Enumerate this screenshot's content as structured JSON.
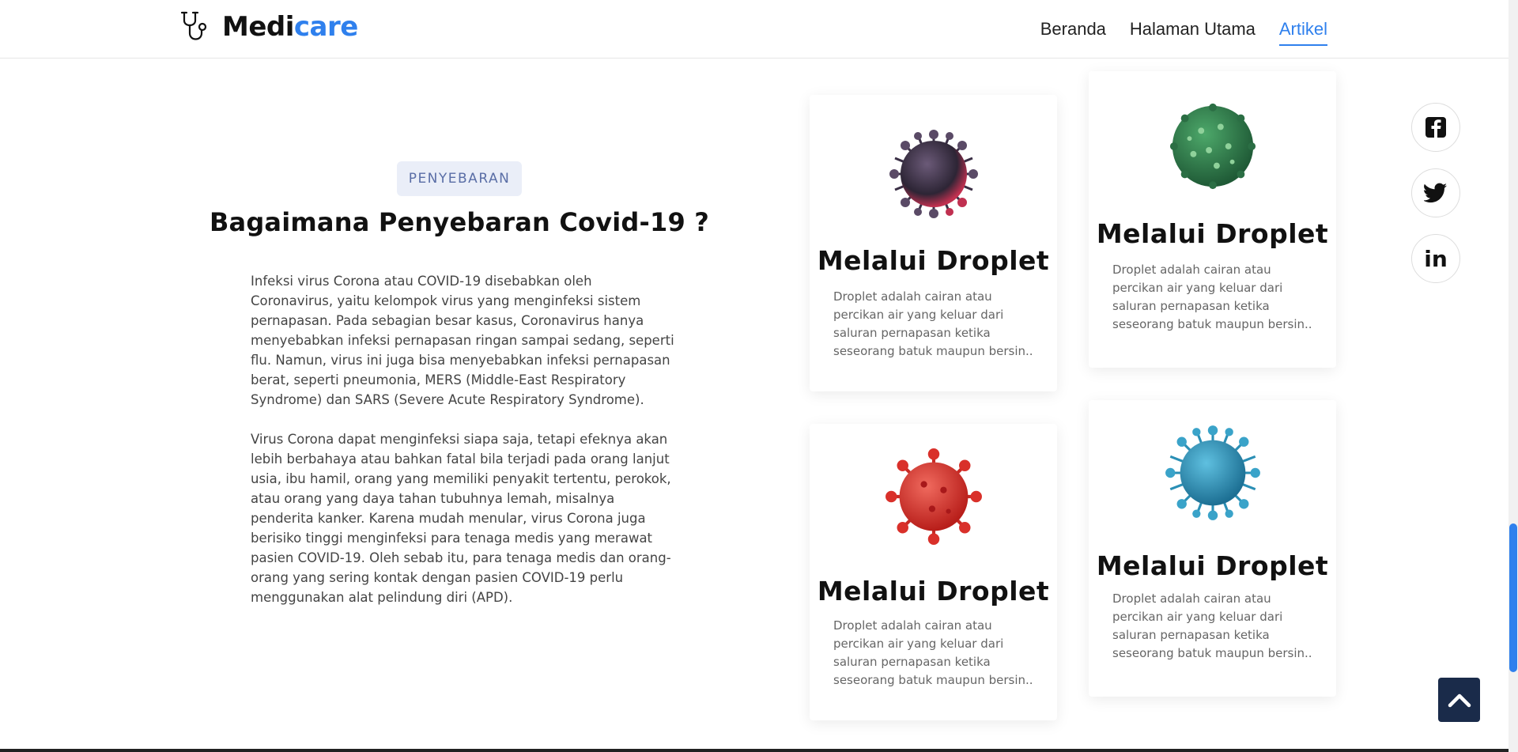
{
  "brand": {
    "name_part1": "Medi",
    "name_part2": "care",
    "accent_color": "#2f80ed",
    "icon": "stethoscope-icon"
  },
  "nav": {
    "items": [
      {
        "label": "Beranda",
        "active": false
      },
      {
        "label": "Halaman Utama",
        "active": false
      },
      {
        "label": "Artikel",
        "active": true
      }
    ]
  },
  "article": {
    "badge": "PENYEBARAN",
    "title": "Bagaimana Penyebaran Covid-19 ?",
    "paragraphs": [
      "Infeksi virus Corona atau COVID-19 disebabkan oleh Coronavirus, yaitu kelompok virus yang menginfeksi sistem pernapasan. Pada sebagian besar kasus, Coronavirus hanya menyebabkan infeksi pernapasan ringan sampai sedang, seperti flu. Namun, virus ini juga bisa menyebabkan infeksi pernapasan berat, seperti pneumonia, MERS (Middle-East Respiratory Syndrome) dan SARS (Severe Acute Respiratory Syndrome).",
      "Virus Corona dapat menginfeksi siapa saja, tetapi efeknya akan lebih berbahaya atau bahkan fatal bila terjadi pada orang lanjut usia, ibu hamil, orang yang memiliki penyakit tertentu, perokok, atau orang yang daya tahan tubuhnya lemah, misalnya penderita kanker. Karena mudah menular, virus Corona juga berisiko tinggi menginfeksi para tenaga medis yang merawat pasien COVID-19. Oleh sebab itu, para tenaga medis dan orang-orang yang sering kontak dengan pasien COVID-19 perlu menggunakan alat pelindung diri (APD)."
    ]
  },
  "cards": [
    {
      "title": "Melalui Droplet",
      "description": "Droplet adalah cairan atau percikan air yang keluar dari saluran pernapasan ketika seseorang batuk maupun bersin..",
      "image": "virus-dark-purple-icon",
      "color": "#4a3a55"
    },
    {
      "title": "Melalui Droplet",
      "description": "Droplet adalah cairan atau percikan air yang keluar dari saluran pernapasan ketika seseorang batuk maupun bersin..",
      "image": "virus-green-icon",
      "color": "#2f7a4a"
    },
    {
      "title": "Melalui Droplet",
      "description": "Droplet adalah cairan atau percikan air yang keluar dari saluran pernapasan ketika seseorang batuk maupun bersin..",
      "image": "virus-red-icon",
      "color": "#d9302a"
    },
    {
      "title": "Melalui Droplet",
      "description": "Droplet adalah cairan atau percikan air yang keluar dari saluran pernapasan ketika seseorang batuk maupun bersin..",
      "image": "virus-blue-icon",
      "color": "#2a8fb5"
    }
  ],
  "social": [
    {
      "icon": "facebook-icon"
    },
    {
      "icon": "twitter-icon"
    },
    {
      "icon": "linkedin-icon",
      "text": "in"
    }
  ],
  "back_to_top": {
    "icon": "chevron-up-icon"
  }
}
